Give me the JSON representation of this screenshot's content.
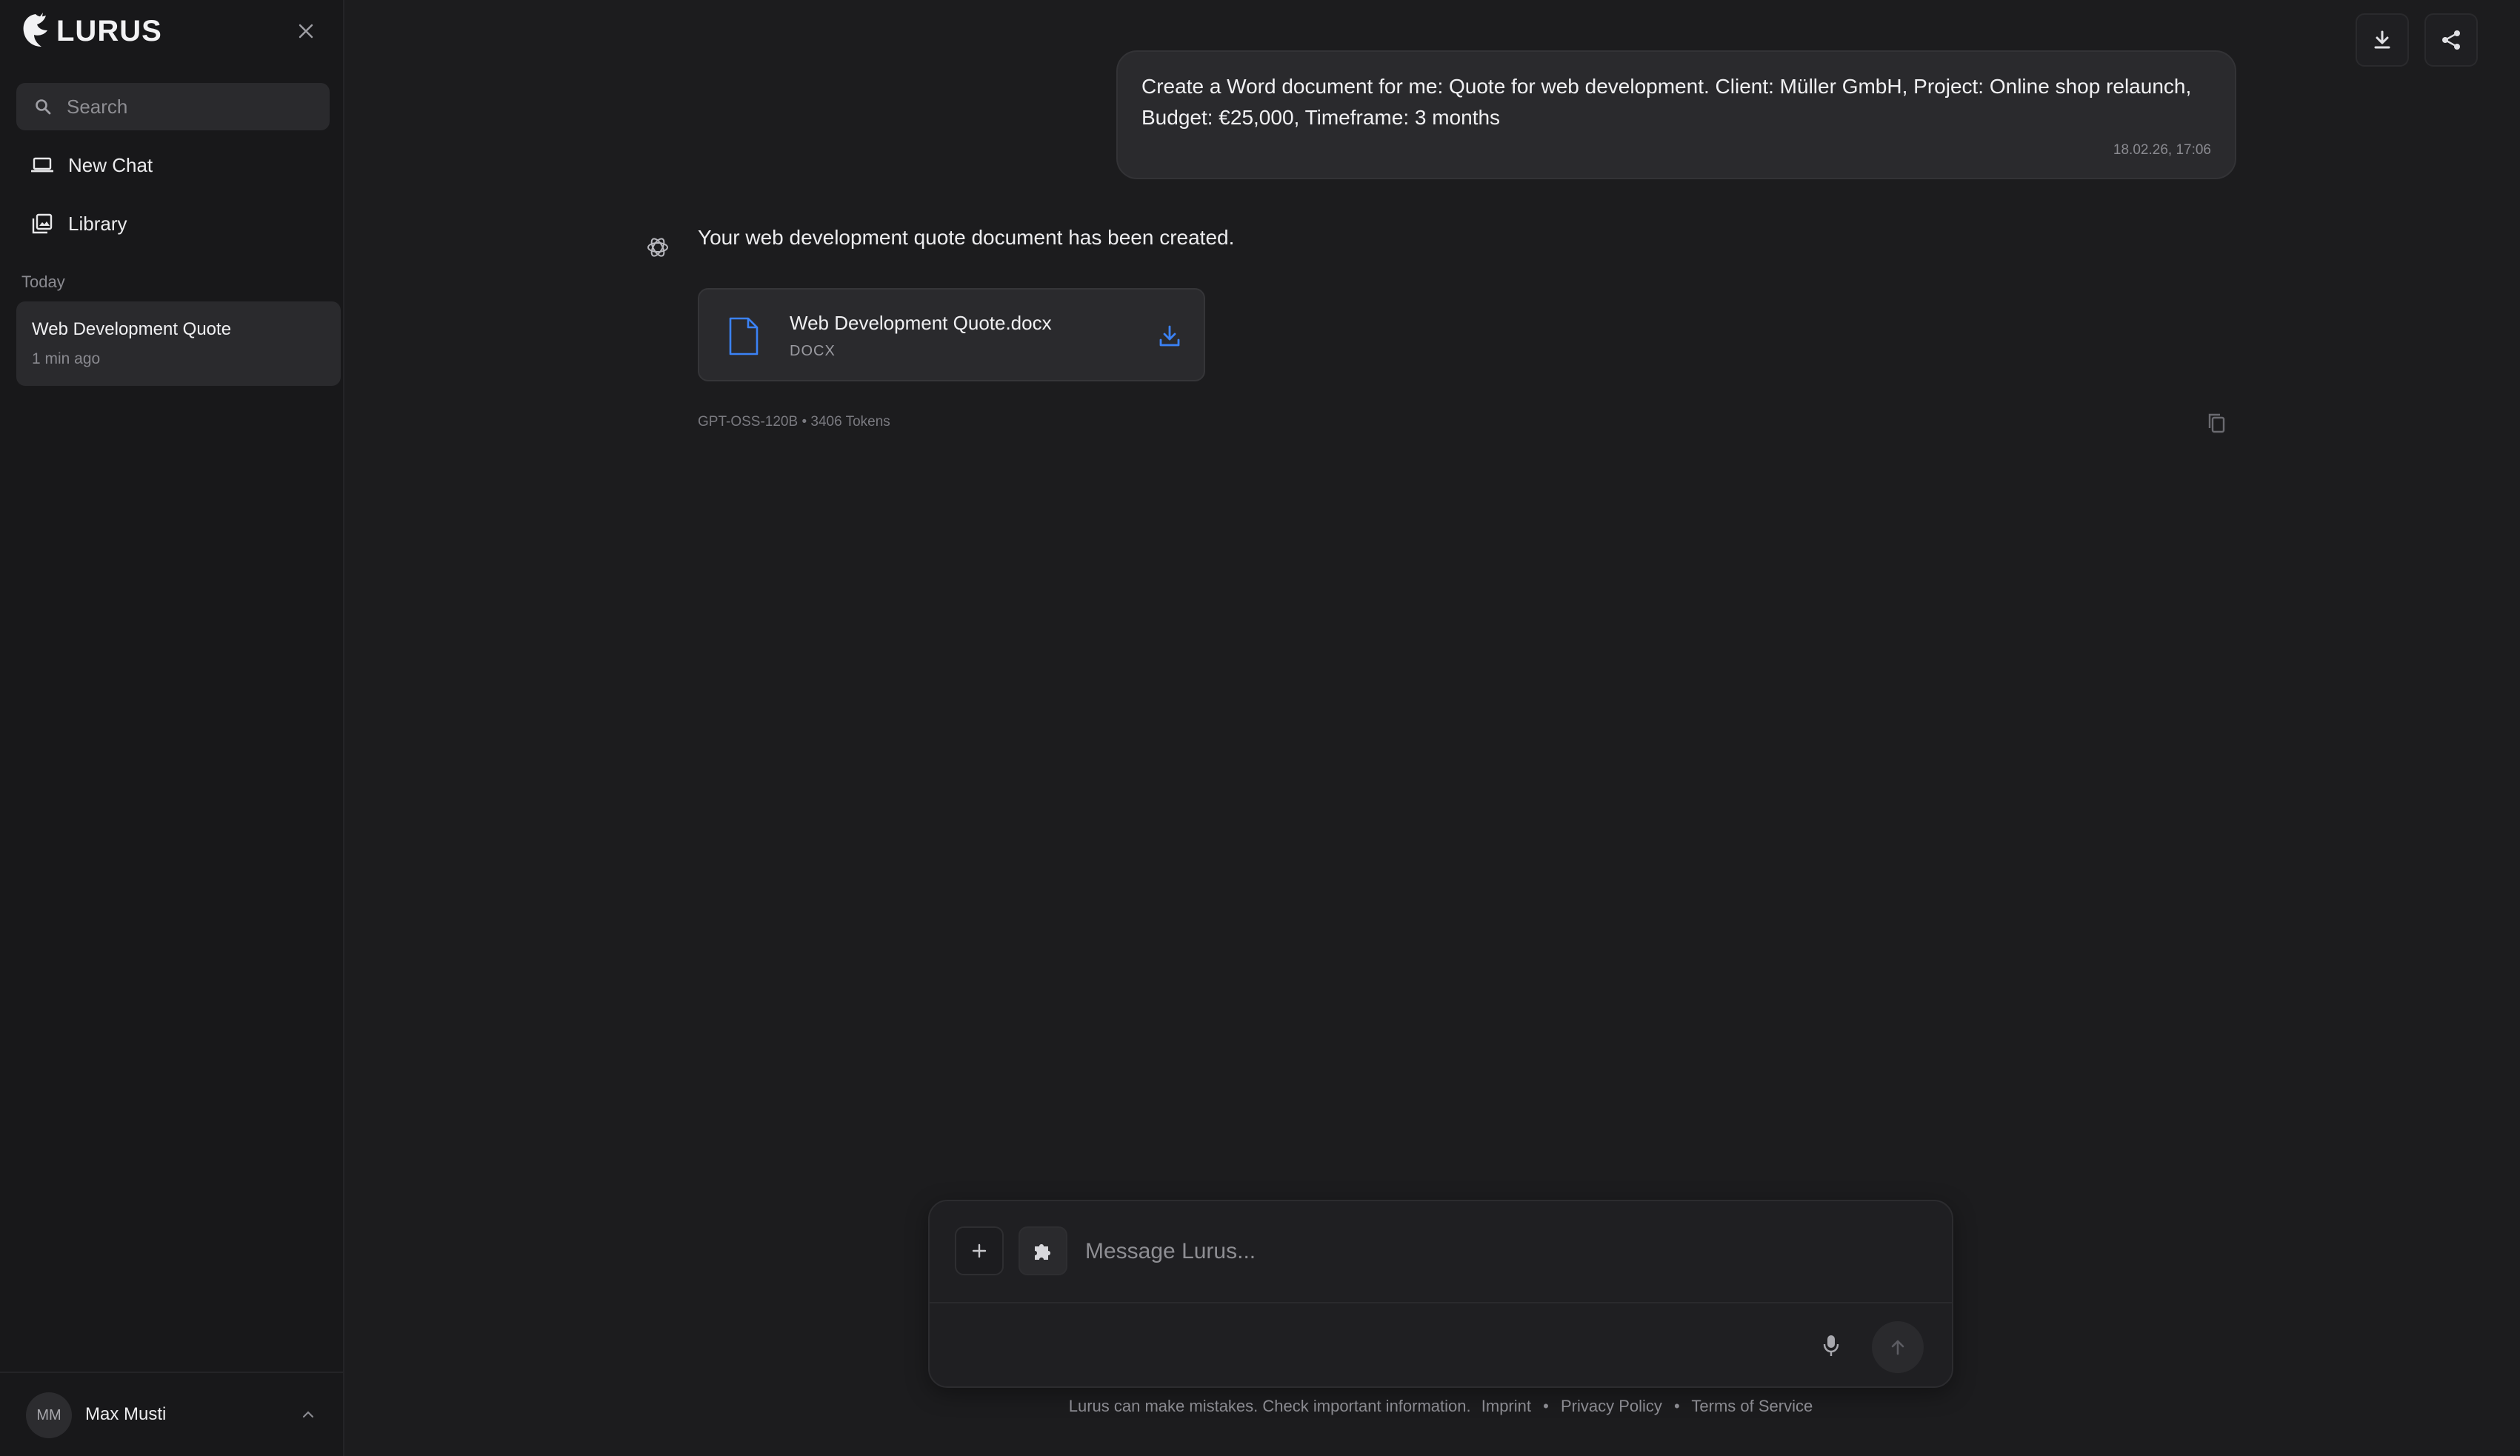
{
  "sidebar": {
    "brand_name": "LURUS",
    "search_placeholder": "Search",
    "nav": {
      "new_chat": "New Chat",
      "library": "Library"
    },
    "section_today": "Today",
    "chats": [
      {
        "title": "Web Development Quote",
        "time": "1 min ago"
      }
    ],
    "user": {
      "initials": "MM",
      "name": "Max Musti"
    }
  },
  "conversation": {
    "user_message": {
      "text": "Create a Word document for me: Quote for web development. Client: Müller GmbH, Project: Online shop relaunch, Budget: €25,000, Timeframe: 3 months",
      "timestamp": "18.02.26, 17:06"
    },
    "assistant_message": {
      "text": "Your web development quote document has been created.",
      "file": {
        "name": "Web Development Quote.docx",
        "type": "DOCX",
        "icon_label": "DOC"
      },
      "meta": "GPT-OSS-120B • 3406 Tokens"
    }
  },
  "composer": {
    "placeholder": "Message Lurus..."
  },
  "footer": {
    "disclaimer": "Lurus can make mistakes. Check important information.",
    "links": [
      "Imprint",
      "Privacy Policy",
      "Terms of Service"
    ]
  },
  "colors": {
    "background": "#1c1c1e",
    "sidebar": "#18181a",
    "surface": "#2a2a2d",
    "accent_blue": "#3b82f6"
  }
}
